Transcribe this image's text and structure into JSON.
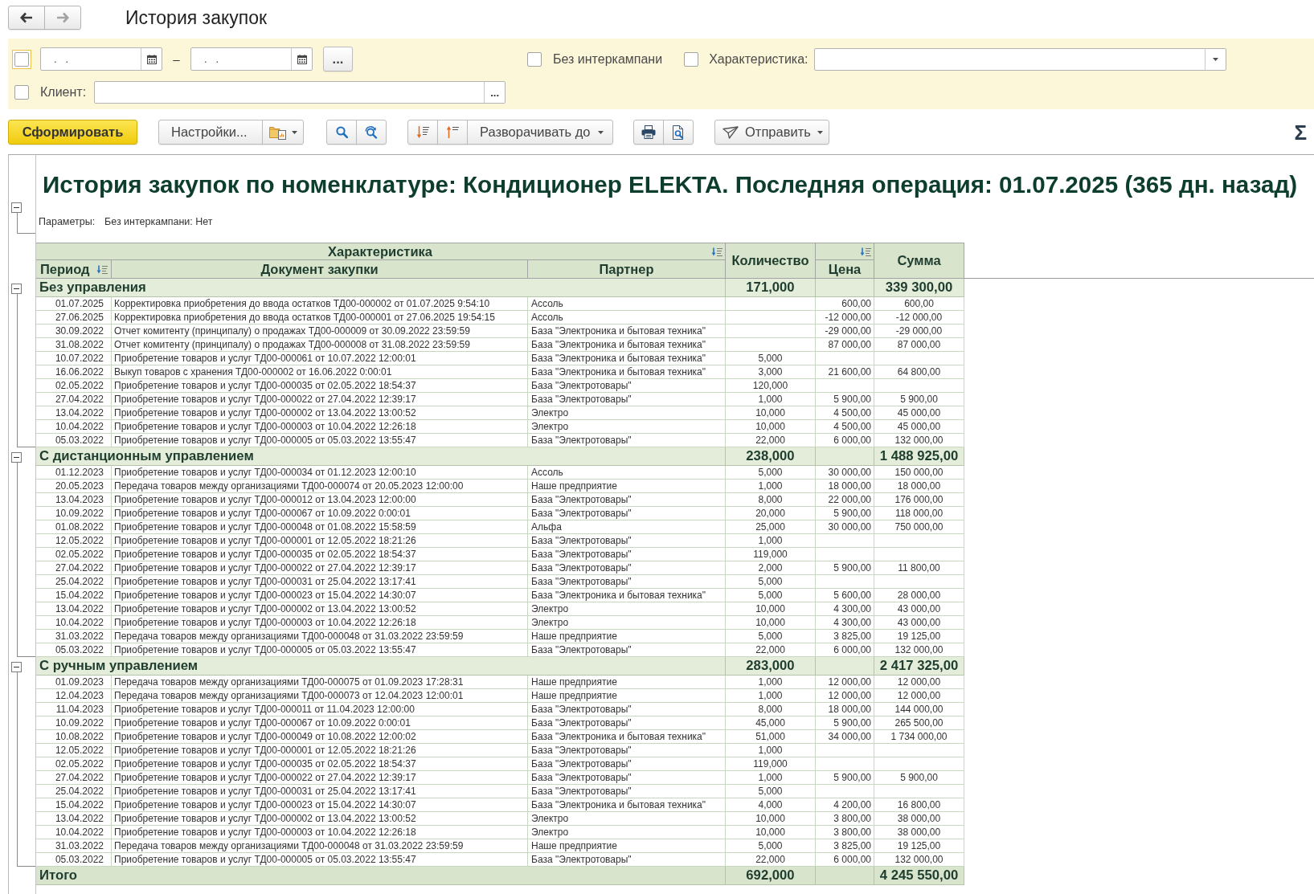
{
  "nav": {
    "back": {
      "disabled": false
    },
    "forward": {
      "disabled": true
    }
  },
  "window": {
    "title": "История закупок"
  },
  "filters": {
    "period_checkbox": {
      "checked": false,
      "focused": true
    },
    "date_from": {
      "value": ".   ."
    },
    "date_separator": "–",
    "date_to": {
      "value": ".   ."
    },
    "period_button": "...",
    "no_intercompany": {
      "label": "Без интеркампани",
      "checked": false,
      "focused": false
    },
    "characteristic": {
      "label": "Характеристика:",
      "checked": false,
      "focused": false
    },
    "client": {
      "label": "Клиент:",
      "checked": false,
      "focused": false,
      "button": "..."
    }
  },
  "toolbar": {
    "generate": "Сформировать",
    "settings": "Настройки...",
    "expand": "Разворачивать до",
    "send": "Отправить",
    "sum": "Σ"
  },
  "report": {
    "expanded": true,
    "title": "История закупок по номенклатуре: Кондиционер ELEKTA. Последняя операция: 01.07.2025 (365 дн. назад)",
    "parameters": {
      "label": "Параметры:",
      "value": "Без интеркампани: Нет"
    },
    "table": {
      "columns": {
        "characteristic": "Характеристика",
        "period": "Период",
        "document": "Документ закупки",
        "partner": "Партнер",
        "quantity": "Количество",
        "price": "Цена",
        "sum": "Сумма"
      },
      "groups": [
        {
          "name": "Без управления",
          "quantity": "171,000",
          "sum": "339 300,00",
          "expanded": true,
          "rows": [
            {
              "period": "01.07.2025",
              "document": "Корректировка приобретения до ввода остатков ТД00-000002 от 01.07.2025 9:54:10",
              "partner": "Ассоль",
              "price": "600,00",
              "sum": "600,00"
            },
            {
              "period": "27.06.2025",
              "document": "Корректировка приобретения до ввода остатков ТД00-000001 от 27.06.2025 19:54:15",
              "partner": "Ассоль",
              "price": "-12 000,00",
              "sum": "-12 000,00"
            },
            {
              "period": "30.09.2022",
              "document": "Отчет комитенту (принципалу) о продажах ТД00-000009 от 30.09.2022 23:59:59",
              "partner": "База \"Электроника и бытовая техника\"",
              "price": "-29 000,00",
              "sum": "-29 000,00"
            },
            {
              "period": "31.08.2022",
              "document": "Отчет комитенту (принципалу) о продажах ТД00-000008 от 31.08.2022 23:59:59",
              "partner": "База \"Электроника и бытовая техника\"",
              "price": "87 000,00",
              "sum": "87 000,00"
            },
            {
              "period": "10.07.2022",
              "document": "Приобретение товаров и услуг ТД00-000061 от 10.07.2022 12:00:01",
              "partner": "База \"Электроника и бытовая техника\"",
              "quantity": "5,000"
            },
            {
              "period": "16.06.2022",
              "document": "Выкуп товаров с хранения ТД00-000002 от 16.06.2022 0:00:01",
              "partner": "База \"Электроника и бытовая техника\"",
              "quantity": "3,000",
              "price": "21 600,00",
              "sum": "64 800,00"
            },
            {
              "period": "02.05.2022",
              "document": "Приобретение товаров и услуг ТД00-000035 от 02.05.2022 18:54:37",
              "partner": "База \"Электротовары\"",
              "quantity": "120,000"
            },
            {
              "period": "27.04.2022",
              "document": "Приобретение товаров и услуг ТД00-000022 от 27.04.2022 12:39:17",
              "partner": "База \"Электротовары\"",
              "quantity": "1,000",
              "price": "5 900,00",
              "sum": "5 900,00"
            },
            {
              "period": "13.04.2022",
              "document": "Приобретение товаров и услуг ТД00-000002 от 13.04.2022 13:00:52",
              "partner": "Электро",
              "quantity": "10,000",
              "price": "4 500,00",
              "sum": "45 000,00"
            },
            {
              "period": "10.04.2022",
              "document": "Приобретение товаров и услуг ТД00-000003 от 10.04.2022 12:26:18",
              "partner": "Электро",
              "quantity": "10,000",
              "price": "4 500,00",
              "sum": "45 000,00"
            },
            {
              "period": "05.03.2022",
              "document": "Приобретение товаров и услуг ТД00-000005 от 05.03.2022 13:55:47",
              "partner": "База \"Электротовары\"",
              "quantity": "22,000",
              "price": "6 000,00",
              "sum": "132 000,00"
            }
          ]
        },
        {
          "name": "С дистанционным управлением",
          "quantity": "238,000",
          "sum": "1 488 925,00",
          "expanded": true,
          "rows": [
            {
              "period": "01.12.2023",
              "document": "Приобретение товаров и услуг ТД00-000034 от 01.12.2023 12:00:10",
              "partner": "Ассоль",
              "quantity": "5,000",
              "price": "30 000,00",
              "sum": "150 000,00"
            },
            {
              "period": "20.05.2023",
              "document": "Передача товаров между организациями ТД00-000074 от 20.05.2023 12:00:00",
              "partner": "Наше предприятие",
              "quantity": "1,000",
              "price": "18 000,00",
              "sum": "18 000,00"
            },
            {
              "period": "13.04.2023",
              "document": "Приобретение товаров и услуг ТД00-000012 от 13.04.2023 12:00:00",
              "partner": "База \"Электротовары\"",
              "quantity": "8,000",
              "price": "22 000,00",
              "sum": "176 000,00"
            },
            {
              "period": "10.09.2022",
              "document": "Приобретение товаров и услуг ТД00-000067 от 10.09.2022 0:00:01",
              "partner": "База \"Электротовары\"",
              "quantity": "20,000",
              "price": "5 900,00",
              "sum": "118 000,00"
            },
            {
              "period": "01.08.2022",
              "document": "Приобретение товаров и услуг ТД00-000048 от 01.08.2022 15:58:59",
              "partner": "Альфа",
              "quantity": "25,000",
              "price": "30 000,00",
              "sum": "750 000,00"
            },
            {
              "period": "12.05.2022",
              "document": "Приобретение товаров и услуг ТД00-000001 от 12.05.2022 18:21:26",
              "partner": "База \"Электротовары\"",
              "quantity": "1,000"
            },
            {
              "period": "02.05.2022",
              "document": "Приобретение товаров и услуг ТД00-000035 от 02.05.2022 18:54:37",
              "partner": "База \"Электротовары\"",
              "quantity": "119,000"
            },
            {
              "period": "27.04.2022",
              "document": "Приобретение товаров и услуг ТД00-000022 от 27.04.2022 12:39:17",
              "partner": "База \"Электротовары\"",
              "quantity": "2,000",
              "price": "5 900,00",
              "sum": "11 800,00"
            },
            {
              "period": "25.04.2022",
              "document": "Приобретение товаров и услуг ТД00-000031 от 25.04.2022 13:17:41",
              "partner": "База \"Электротовары\"",
              "quantity": "5,000"
            },
            {
              "period": "15.04.2022",
              "document": "Приобретение товаров и услуг ТД00-000023 от 15.04.2022 14:30:07",
              "partner": "База \"Электроника и бытовая техника\"",
              "quantity": "5,000",
              "price": "5 600,00",
              "sum": "28 000,00"
            },
            {
              "period": "13.04.2022",
              "document": "Приобретение товаров и услуг ТД00-000002 от 13.04.2022 13:00:52",
              "partner": "Электро",
              "quantity": "10,000",
              "price": "4 300,00",
              "sum": "43 000,00"
            },
            {
              "period": "10.04.2022",
              "document": "Приобретение товаров и услуг ТД00-000003 от 10.04.2022 12:26:18",
              "partner": "Электро",
              "quantity": "10,000",
              "price": "4 300,00",
              "sum": "43 000,00"
            },
            {
              "period": "31.03.2022",
              "document": "Передача товаров между организациями ТД00-000048 от 31.03.2022 23:59:59",
              "partner": "Наше предприятие",
              "quantity": "5,000",
              "price": "3 825,00",
              "sum": "19 125,00"
            },
            {
              "period": "05.03.2022",
              "document": "Приобретение товаров и услуг ТД00-000005 от 05.03.2022 13:55:47",
              "partner": "База \"Электротовары\"",
              "quantity": "22,000",
              "price": "6 000,00",
              "sum": "132 000,00"
            }
          ]
        },
        {
          "name": "С ручным управлением",
          "quantity": "283,000",
          "sum": "2 417 325,00",
          "expanded": true,
          "rows": [
            {
              "period": "01.09.2023",
              "document": "Передача товаров между организациями ТД00-000075 от 01.09.2023 17:28:31",
              "partner": "Наше предприятие",
              "quantity": "1,000",
              "price": "12 000,00",
              "sum": "12 000,00"
            },
            {
              "period": "12.04.2023",
              "document": "Передача товаров между организациями ТД00-000073 от 12.04.2023 12:00:01",
              "partner": "Наше предприятие",
              "quantity": "1,000",
              "price": "12 000,00",
              "sum": "12 000,00"
            },
            {
              "period": "11.04.2023",
              "document": "Приобретение товаров и услуг ТД00-000011 от 11.04.2023 12:00:00",
              "partner": "База \"Электротовары\"",
              "quantity": "8,000",
              "price": "18 000,00",
              "sum": "144 000,00"
            },
            {
              "period": "10.09.2022",
              "document": "Приобретение товаров и услуг ТД00-000067 от 10.09.2022 0:00:01",
              "partner": "База \"Электротовары\"",
              "quantity": "45,000",
              "price": "5 900,00",
              "sum": "265 500,00"
            },
            {
              "period": "10.08.2022",
              "document": "Приобретение товаров и услуг ТД00-000049 от 10.08.2022 12:00:02",
              "partner": "База \"Электроника и бытовая техника\"",
              "quantity": "51,000",
              "price": "34 000,00",
              "sum": "1 734 000,00"
            },
            {
              "period": "12.05.2022",
              "document": "Приобретение товаров и услуг ТД00-000001 от 12.05.2022 18:21:26",
              "partner": "База \"Электротовары\"",
              "quantity": "1,000"
            },
            {
              "period": "02.05.2022",
              "document": "Приобретение товаров и услуг ТД00-000035 от 02.05.2022 18:54:37",
              "partner": "База \"Электротовары\"",
              "quantity": "119,000"
            },
            {
              "period": "27.04.2022",
              "document": "Приобретение товаров и услуг ТД00-000022 от 27.04.2022 12:39:17",
              "partner": "База \"Электротовары\"",
              "quantity": "1,000",
              "price": "5 900,00",
              "sum": "5 900,00"
            },
            {
              "period": "25.04.2022",
              "document": "Приобретение товаров и услуг ТД00-000031 от 25.04.2022 13:17:41",
              "partner": "База \"Электротовары\"",
              "quantity": "5,000"
            },
            {
              "period": "15.04.2022",
              "document": "Приобретение товаров и услуг ТД00-000023 от 15.04.2022 14:30:07",
              "partner": "База \"Электроника и бытовая техника\"",
              "quantity": "4,000",
              "price": "4 200,00",
              "sum": "16 800,00"
            },
            {
              "period": "13.04.2022",
              "document": "Приобретение товаров и услуг ТД00-000002 от 13.04.2022 13:00:52",
              "partner": "Электро",
              "quantity": "10,000",
              "price": "3 800,00",
              "sum": "38 000,00"
            },
            {
              "period": "10.04.2022",
              "document": "Приобретение товаров и услуг ТД00-000003 от 10.04.2022 12:26:18",
              "partner": "Электро",
              "quantity": "10,000",
              "price": "3 800,00",
              "sum": "38 000,00"
            },
            {
              "period": "31.03.2022",
              "document": "Передача товаров между организациями ТД00-000048 от 31.03.2022 23:59:59",
              "partner": "Наше предприятие",
              "quantity": "5,000",
              "price": "3 825,00",
              "sum": "19 125,00"
            },
            {
              "period": "05.03.2022",
              "document": "Приобретение товаров и услуг ТД00-000005 от 05.03.2022 13:55:47",
              "partner": "База \"Электротовары\"",
              "quantity": "22,000",
              "price": "6 000,00",
              "sum": "132 000,00"
            }
          ]
        }
      ],
      "total": {
        "label": "Итого",
        "quantity": "692,000",
        "sum": "4 245 550,00"
      }
    }
  }
}
